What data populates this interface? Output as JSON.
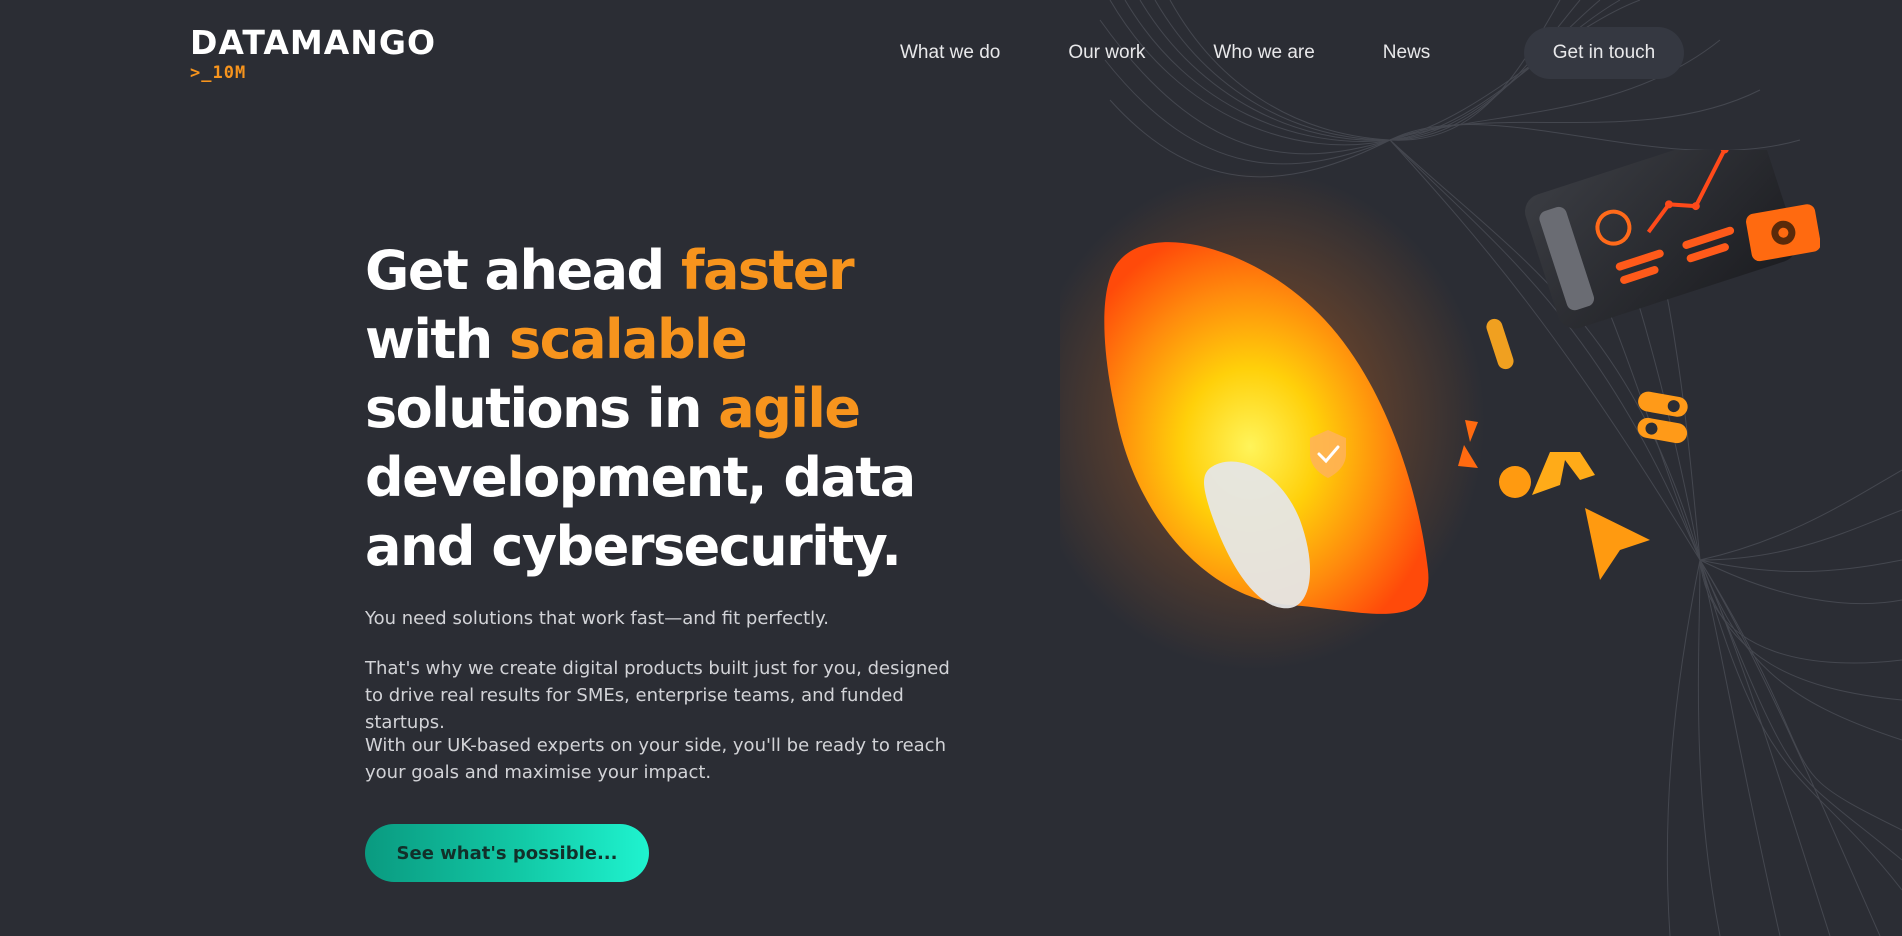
{
  "brand": {
    "name": "DATAMANGO",
    "tagline": ">_10M",
    "accent_color": "#f7941d",
    "background_color": "#2b2d34"
  },
  "nav": {
    "items": [
      {
        "label": "What we do"
      },
      {
        "label": "Our work"
      },
      {
        "label": "Who we are"
      },
      {
        "label": "News"
      }
    ],
    "cta_label": "Get in touch"
  },
  "hero": {
    "headline": [
      {
        "text": "Get ahead ",
        "accent": false
      },
      {
        "text": "faster",
        "accent": true
      },
      {
        "text": "with ",
        "accent": false
      },
      {
        "text": "scalable",
        "accent": true
      },
      {
        "text": "solutions in ",
        "accent": false
      },
      {
        "text": "agile",
        "accent": true
      },
      {
        "text": "development, data",
        "accent": false
      },
      {
        "text": "and cybersecurity.",
        "accent": false
      }
    ],
    "paragraphs": [
      "You need solutions that work fast—and fit perfectly.",
      "That's why we create digital products built just for you, designed to drive real results for SMEs, enterprise teams, and funded startups.",
      "With our UK-based experts on your side, you'll be ready to reach your goals and maximise your impact."
    ],
    "cta_label": "See what's possible...",
    "cta_colors": [
      "#0a9a80",
      "#1ff3cf"
    ]
  },
  "illustration": {
    "icons": [
      "mango-shape",
      "shield-check-icon",
      "tablet-chart-icon",
      "gear-icon",
      "toggle-icon",
      "cursor-arrow-icon",
      "capsule-icon"
    ]
  }
}
